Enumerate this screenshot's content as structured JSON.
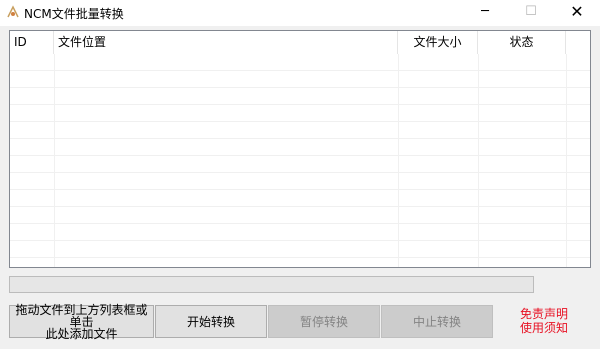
{
  "window": {
    "title": "NCM文件批量转换",
    "app_icon": "ncm-app-icon",
    "controls": {
      "minimize": "─",
      "maximize": "☐",
      "close": "✕"
    }
  },
  "list": {
    "columns": [
      "ID",
      "文件位置",
      "文件大小",
      "状态"
    ],
    "rows": []
  },
  "progress": {
    "value": 0
  },
  "buttons": {
    "add_line1": "拖动文件到上方列表框或单击",
    "add_line2": "此处添加文件",
    "start": "开始转换",
    "pause": "暂停转换",
    "stop": "中止转换"
  },
  "disclaimer": {
    "line1": "免责声明",
    "line2": "使用须知"
  },
  "colors": {
    "disclaimer": "#e81123",
    "disabled_text": "#838383"
  }
}
